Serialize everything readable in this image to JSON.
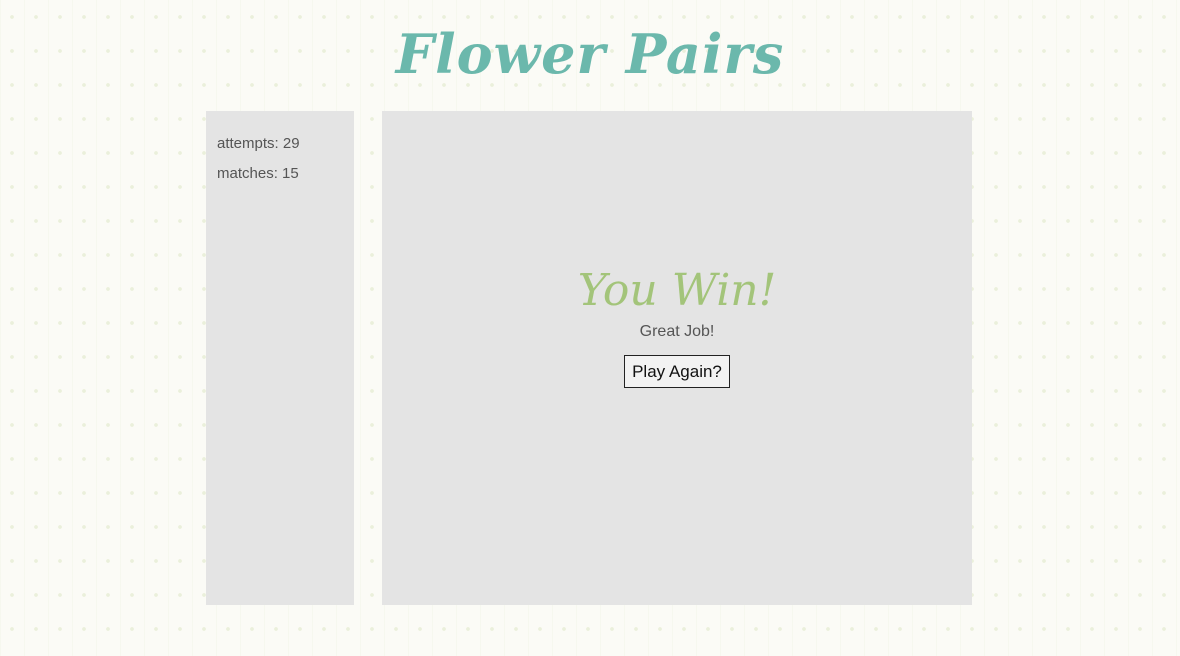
{
  "header": {
    "title": "Flower Pairs"
  },
  "stats": {
    "attempts_label": "attempts:",
    "attempts_value": "29",
    "matches_label": "matches:",
    "matches_value": "15"
  },
  "win_screen": {
    "heading": "You Win!",
    "message": "Great Job!",
    "play_again_label": "Play Again?"
  },
  "colors": {
    "title": "#6bb8ac",
    "win_heading": "#a3c47a",
    "panel_background": "#e4e4e4",
    "page_background": "#fbfbf6",
    "text": "#555555"
  }
}
